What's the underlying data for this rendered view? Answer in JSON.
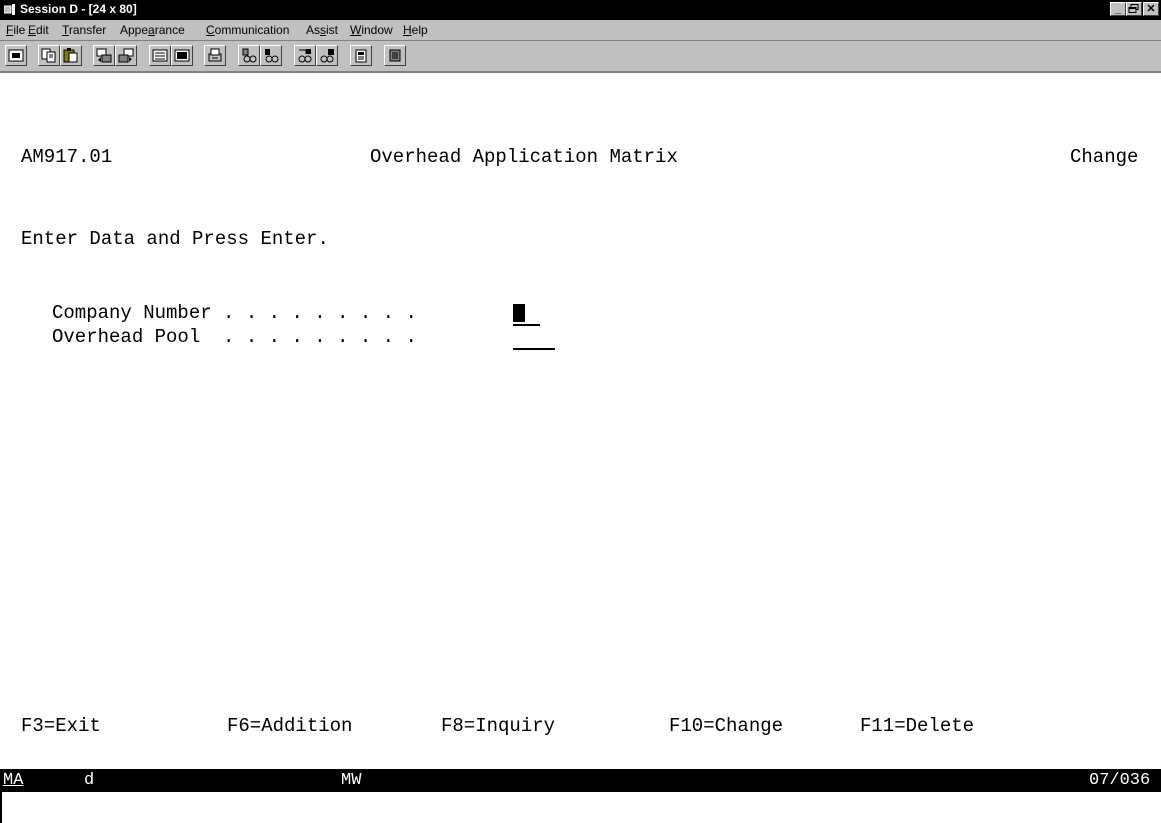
{
  "window": {
    "title": "Session D - [24 x 80]",
    "minimize_glyph": "_",
    "maximize_glyph": "▫",
    "close_glyph": "✕"
  },
  "menu": {
    "file": {
      "acc": "F",
      "rest": "ile"
    },
    "edit": {
      "acc": "E",
      "rest": "dit"
    },
    "transfer": {
      "acc": "T",
      "rest": "ransfer"
    },
    "appearance": {
      "pre": "Appe",
      "acc": "a",
      "rest": "rance"
    },
    "communication": {
      "acc": "C",
      "rest": "ommunication"
    },
    "assist": {
      "pre": "As",
      "acc": "s",
      "rest": "ist"
    },
    "window": {
      "acc": "W",
      "rest": "indow"
    },
    "help": {
      "acc": "H",
      "rest": "elp"
    }
  },
  "toolbar": {
    "icons": [
      "display-icon",
      "copy-icon",
      "paste-icon",
      "send-icon",
      "receive-icon",
      "keypad-icon",
      "macro-icon",
      "print-icon",
      "record-macro-icon",
      "play-macro-icon",
      "start-transfer-icon",
      "stop-transfer-icon",
      "clipboard-icon",
      "settings-icon"
    ]
  },
  "screen": {
    "program_id": "AM917.01",
    "title": "Overhead Application Matrix",
    "mode": "Change",
    "instruction": "Enter Data and Press Enter.",
    "fields": {
      "company_label": "Company Number . . . . . . . . .",
      "company_value": "",
      "pool_label": "Overhead Pool  . . . . . . . . .",
      "pool_value": ""
    },
    "function_keys": {
      "f3": "F3=Exit",
      "f6": "F6=Addition",
      "f8": "F8=Inquiry",
      "f10": "F10=Change",
      "f11": "F11=Delete"
    }
  },
  "status": {
    "indicator": "MA",
    "session": "d",
    "mw": "MW",
    "cursor_position": "07/036"
  }
}
